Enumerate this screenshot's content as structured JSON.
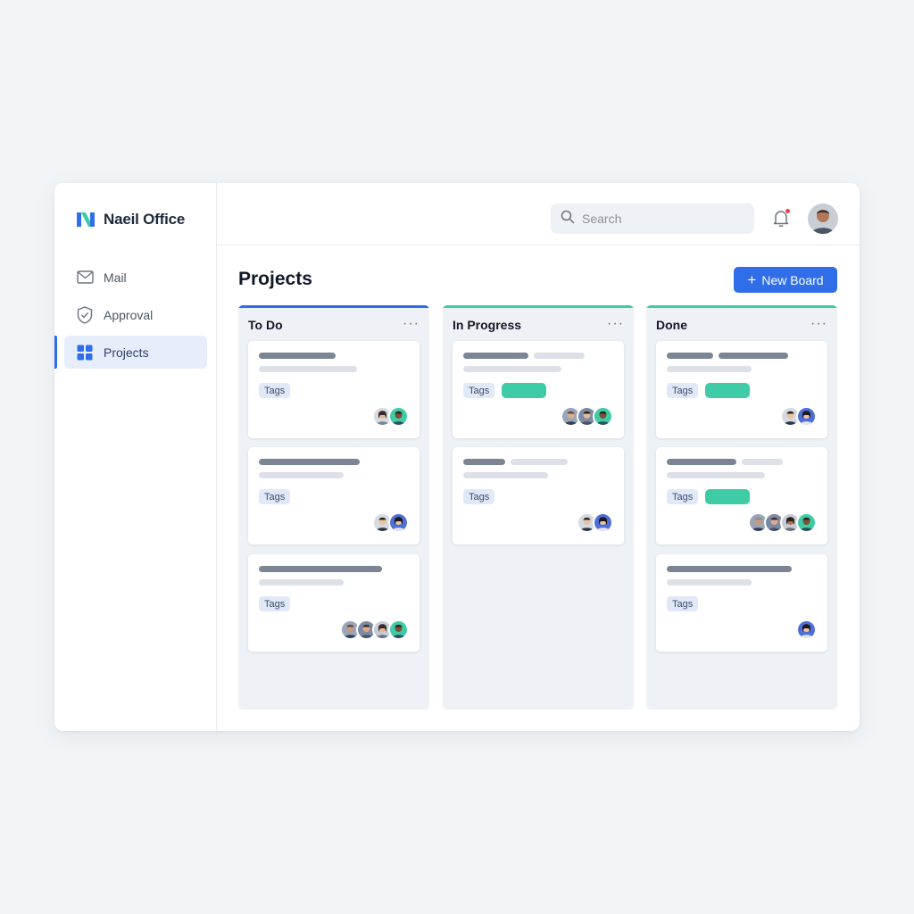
{
  "app": {
    "name": "Naeil Office"
  },
  "sidebar": {
    "items": [
      {
        "label": "Mail",
        "icon": "mail-icon",
        "active": false
      },
      {
        "label": "Approval",
        "icon": "shield-check-icon",
        "active": false
      },
      {
        "label": "Projects",
        "icon": "grid-icon",
        "active": true
      }
    ]
  },
  "header": {
    "search_placeholder": "Search",
    "has_notification": true
  },
  "main": {
    "title": "Projects",
    "new_board_label": "New Board",
    "new_board_icon": "plus-icon"
  },
  "colors": {
    "accent": "#2f6ee8",
    "done_green": "#3ecba6",
    "notification": "#ef4444"
  },
  "columns": [
    {
      "title": "To Do",
      "accent": "#2f6ee8",
      "menu": "···",
      "cards": [
        {
          "tag": "Tags",
          "has_status_pill": false,
          "avatar_count": 2
        },
        {
          "tag": "Tags",
          "has_status_pill": false,
          "avatar_count": 2
        },
        {
          "tag": "Tags",
          "has_status_pill": false,
          "avatar_count": 4
        }
      ]
    },
    {
      "title": "In Progress",
      "accent": "#3ecba6",
      "menu": "···",
      "cards": [
        {
          "tag": "Tags",
          "has_status_pill": true,
          "avatar_count": 3
        },
        {
          "tag": "Tags",
          "has_status_pill": false,
          "avatar_count": 2
        }
      ]
    },
    {
      "title": "Done",
      "accent": "#3ecba6",
      "menu": "···",
      "cards": [
        {
          "tag": "Tags",
          "has_status_pill": true,
          "avatar_count": 2
        },
        {
          "tag": "Tags",
          "has_status_pill": true,
          "avatar_count": 4
        },
        {
          "tag": "Tags",
          "has_status_pill": false,
          "avatar_count": 1
        }
      ]
    }
  ]
}
